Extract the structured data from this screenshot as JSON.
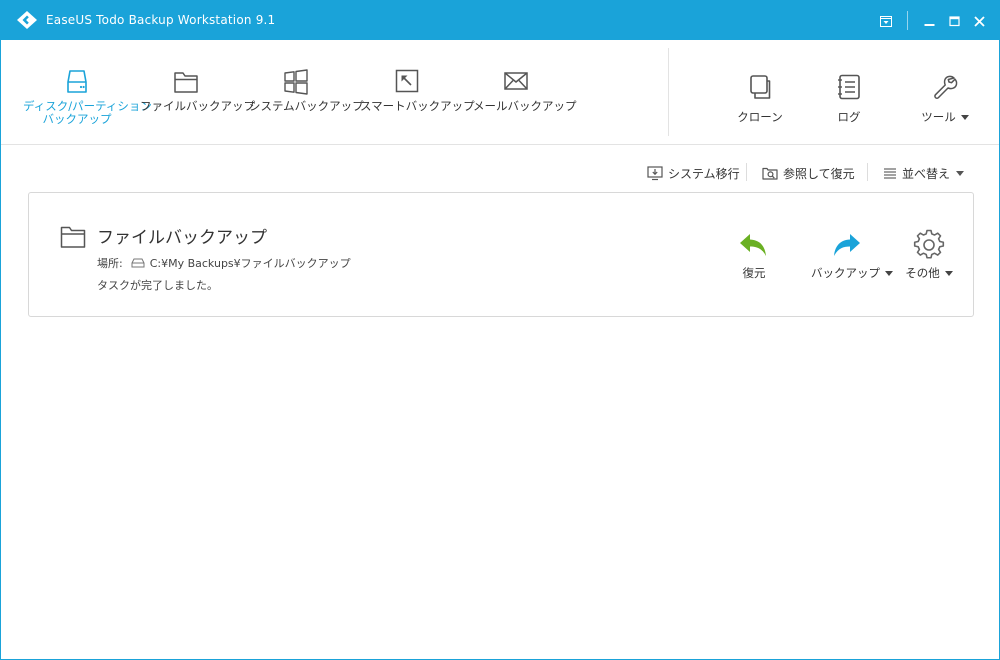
{
  "window": {
    "title": "EaseUS Todo Backup Workstation 9.1",
    "colors": {
      "accent": "#1aa3d9",
      "restore_green": "#6ab023",
      "backup_blue": "#1aa3d9"
    }
  },
  "toolbar": {
    "tools": [
      {
        "label_line1": "ディスク/パーティション",
        "label_line2": "バックアップ",
        "icon": "disk-icon",
        "active": true
      },
      {
        "label": "ファイルバックアップ",
        "icon": "folder-icon"
      },
      {
        "label": "システムバックアップ",
        "icon": "windows-icon"
      },
      {
        "label": "スマートバックアップ",
        "icon": "smart-backup-icon"
      },
      {
        "label": "メールバックアップ",
        "icon": "envelope-icon"
      }
    ],
    "right_tools": [
      {
        "label": "クローン",
        "icon": "clone-icon"
      },
      {
        "label": "ログ",
        "icon": "log-icon"
      },
      {
        "label": "ツール",
        "icon": "wrench-icon",
        "has_dropdown": true
      }
    ]
  },
  "actions": {
    "system_transfer": "システム移行",
    "browse_restore": "参照して復元",
    "sort": "並べ替え"
  },
  "task": {
    "title": "ファイルバックアップ",
    "location_label": "場所:",
    "location_path": "C:¥My Backups¥ファイルバックアップ",
    "status": "タスクが完了しました。",
    "actions": {
      "restore": "復元",
      "backup": "バックアップ",
      "more": "その他"
    }
  }
}
